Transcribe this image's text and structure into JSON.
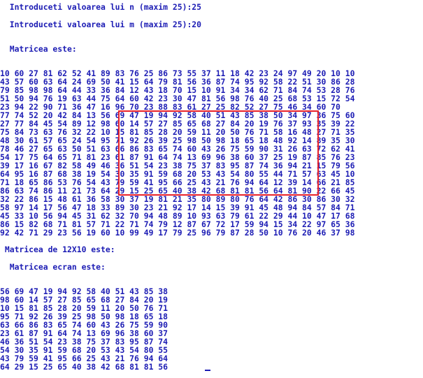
{
  "prompt_n": "  Introduceti valoarea lui n (maxim 25):25",
  "prompt_m": "  Introduceti valoarea lui m (maxim 25):20",
  "matrix_title": "  Matricea este:",
  "matrix_rows": [
    "10 60 27 81 62 52 41 89 83 76 25 86 73 55 37 11 18 42 23 24 97 49 20 10 10",
    "43 57 60 63 64 24 69 50 41 15 64 79 81 56 36 87 74 95 92 58 22 51 30 86 28",
    "79 85 98 98 64 44 33 36 84 12 43 18 70 15 10 91 34 34 62 71 84 74 53 28 76",
    "51 50 94 76 19 63 44 75 64 60 42 23 30 47 81 56 98 76 40 25 68 53 15 72 54",
    "23 94 22 90 71 36 47 16 96 70 23 88 83 61 27 25 82 52 27 75 46 34 60 70",
    "77 74 52 20 42 84 13 56 69 47 19 94 92 58 40 51 43 85 38 50 34 97 36 75 60",
    "27 77 84 45 54 89 12 98 60 14 57 27 85 65 68 27 84 20 19 76 37 93 35 39 22",
    "75 84 73 63 76 32 22 10 15 81 85 28 20 59 11 20 50 76 71 58 16 48 27 71 35",
    "48 30 61 57 65 24 54 95 71 92 26 39 25 98 50 98 18 65 18 48 92 14 89 35 30",
    "78 46 27 65 63 50 51 63 66 86 83 65 74 60 43 26 75 59 90 31 26 63 72 62 41",
    "54 17 75 64 65 71 81 23 61 87 91 64 74 13 69 96 38 60 37 25 19 87 85 76 23",
    "39 17 16 67 82 58 49 46 36 51 54 23 38 75 37 83 95 87 74 36 94 21 15 79 56",
    "64 95 16 87 68 38 19 54 30 35 91 59 68 20 53 43 54 80 55 44 71 57 63 45 10",
    "71 18 65 86 53 76 54 43 79 59 41 95 66 25 43 21 76 94 64 12 39 14 66 21 85",
    "86 63 74 86 11 21 73 64 29 15 25 65 40 38 42 68 81 81 56 64 81 90 22 66 45",
    "32 22 86 15 48 61 36 58 30 37 19 81 21 35 80 89 80 76 64 42 86 30 86 30 32",
    "58 97 14 17 56 47 18 33 89 30 23 21 92 17 14 15 39 91 45 48 94 84 57 84 71",
    "45 33 10 56 94 45 31 62 32 70 94 48 89 10 93 63 79 61 22 29 44 10 47 17 68",
    "86 15 82 68 71 81 57 71 22 71 74 79 12 87 67 72 17 59 94 15 34 22 97 65 36",
    "92 42 71 29 23 56 19 60 10 99 49 17 79 25 96 79 87 28 50 10 76 20 46 37 98"
  ],
  "submatrix_title": " Matricea de 12X10 este:",
  "screen_title": "  Matricea ecran este:",
  "screen_rows": [
    "56 69 47 19 94 92 58 40 51 43 85 38",
    "98 60 14 57 27 85 65 68 27 84 20 19",
    "10 15 81 85 28 20 59 11 20 50 76 71",
    "95 71 92 26 39 25 98 50 98 18 65 18",
    "63 66 86 83 65 74 60 43 26 75 59 90",
    "23 61 87 91 64 74 13 69 96 38 60 37",
    "46 36 51 54 23 38 75 37 83 95 87 74",
    "54 30 35 91 59 68 20 53 43 54 80 55",
    "43 79 59 41 95 66 25 43 21 76 94 64",
    "64 29 15 25 65 40 38 42 68 81 81 56"
  ],
  "colors": {
    "text": "#1c1cb4",
    "highlight": "#e8222a",
    "background": "#ffffff"
  }
}
